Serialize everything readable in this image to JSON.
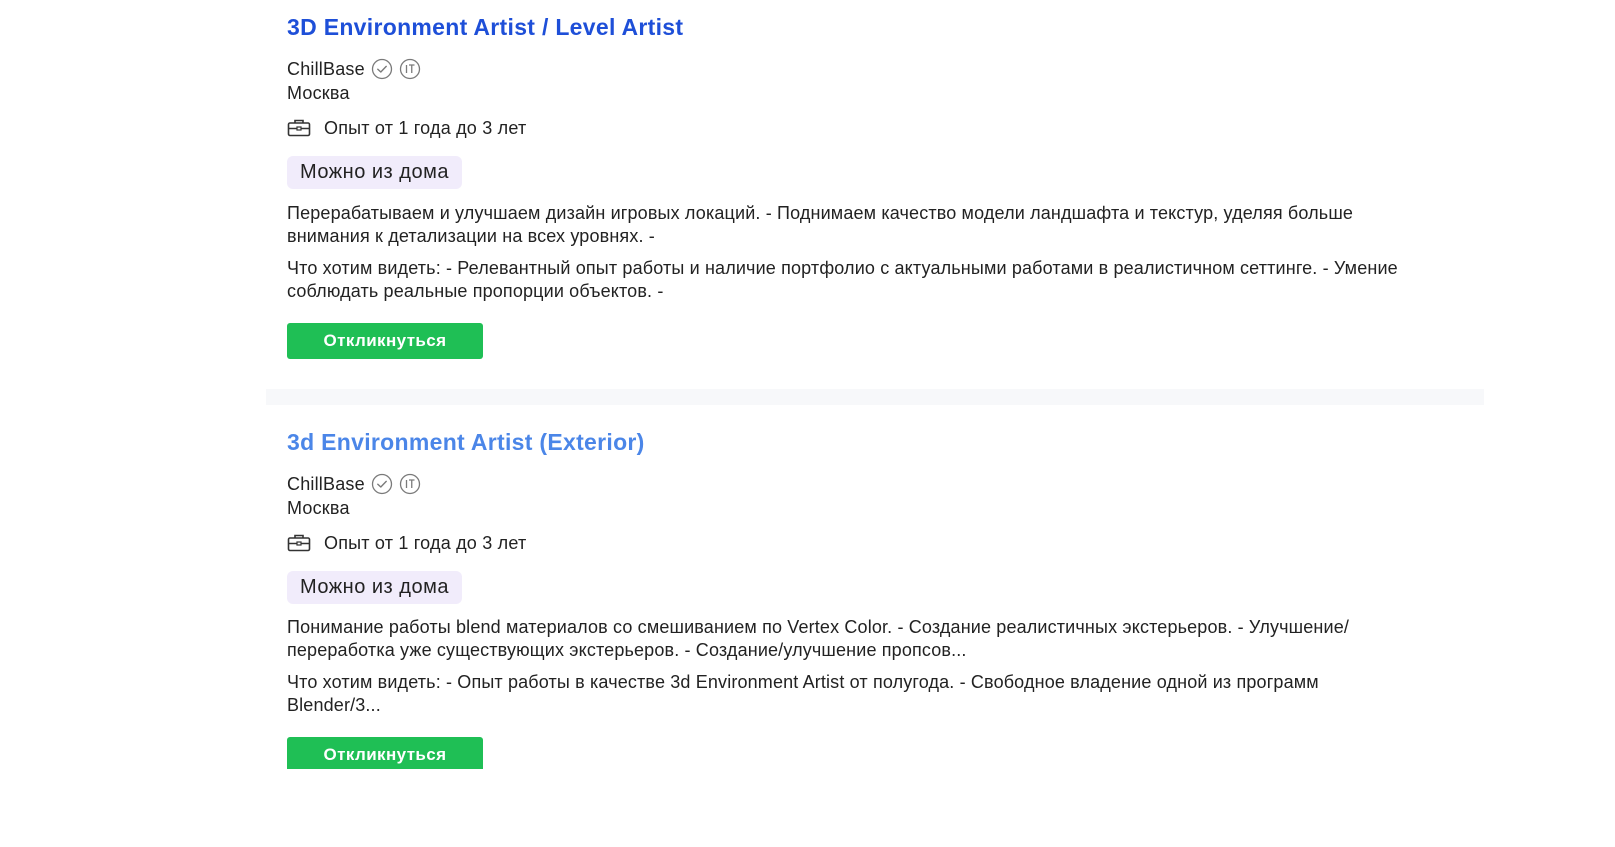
{
  "vacancies": [
    {
      "title": "3D Environment Artist / Level Artist",
      "company": "ChillBase",
      "city": "Москва",
      "experience": "Опыт от 1 года до 3 лет",
      "tag": "Можно из дома",
      "responsibilities": "Перерабатываем и улучшаем дизайн игровых локаций. - Поднимаем качество модели ландшафта и текстур, уделяя больше внимания к детализации на всех уровнях. -",
      "requirements": "Что хотим видеть: - Релевантный опыт работы и наличие портфолио с актуальными работами в реалистичном сеттинге. - Умение соблюдать реальные пропорции объектов. -",
      "apply_label": "Откликнуться",
      "title_color": "#1e4fd8"
    },
    {
      "title": "3d Environment Artist (Exterior)",
      "company": "ChillBase",
      "city": "Москва",
      "experience": "Опыт от 1 года до 3 лет",
      "tag": "Можно из дома",
      "responsibilities": "Понимание работы blend материалов со смешиванием по Vertex Color. - Создание реалистичных экстерьеров. - Улучшение/переработка уже существующих экстерьеров. - Создание/улучшение пропсов...",
      "requirements": "Что хотим видеть: - Опыт работы в качестве 3d Environment Artist от полугода. - Свободное владение одной из программ Blender/3...",
      "apply_label": "Откликнуться",
      "title_color": "#4b86e8"
    }
  ],
  "icons": {
    "verified": "check-circle-icon",
    "it_company": "it-badge-icon",
    "experience": "briefcase-icon"
  },
  "colors": {
    "apply_button": "#1fbf55",
    "tag_background": "#f1ecfb"
  }
}
